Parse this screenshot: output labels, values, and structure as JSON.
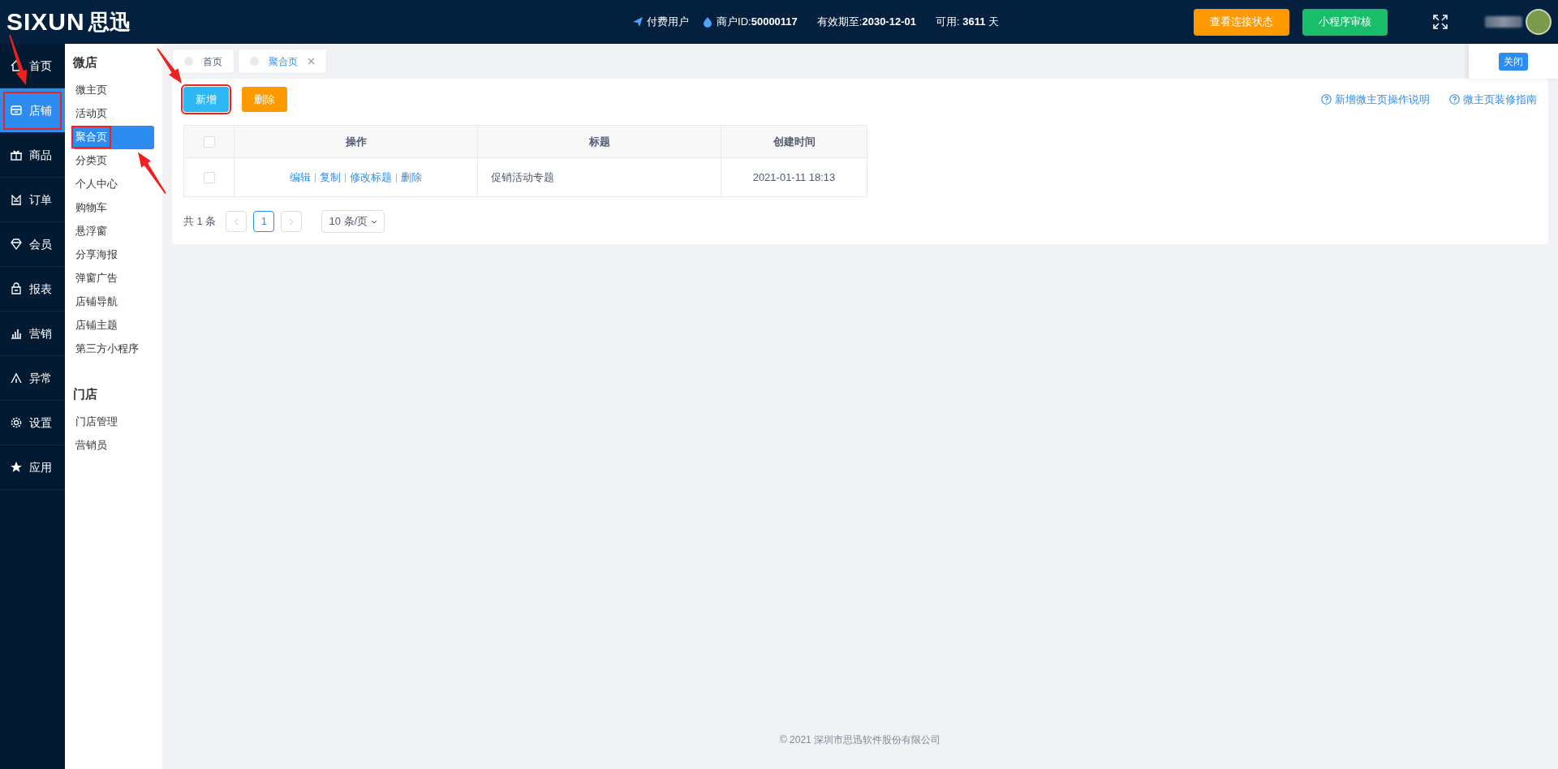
{
  "header": {
    "logo_latin": "SIXUN",
    "logo_cjk": "思迅",
    "user_type": "付费用户",
    "merchant_label": "商户ID:",
    "merchant_id": "50000117",
    "expiry_label": "有效期至:",
    "expiry": "2030-12-01",
    "available_label": "可用:",
    "available_days": "3611",
    "days_unit": "天",
    "buttons": [
      {
        "label": "查看连接状态",
        "kind": "warning"
      },
      {
        "label": "小程序审核",
        "kind": "success"
      }
    ]
  },
  "nav": [
    {
      "label": "首页",
      "selected": false,
      "highlighted": false
    },
    {
      "label": "店铺",
      "selected": true,
      "highlighted": true
    },
    {
      "label": "商品",
      "selected": false,
      "highlighted": false
    },
    {
      "label": "订单",
      "selected": false,
      "highlighted": false
    },
    {
      "label": "会员",
      "selected": false,
      "highlighted": false
    },
    {
      "label": "报表",
      "selected": false,
      "highlighted": false
    },
    {
      "label": "营销",
      "selected": false,
      "highlighted": false
    },
    {
      "label": "异常",
      "selected": false,
      "highlighted": false
    },
    {
      "label": "设置",
      "selected": false,
      "highlighted": false
    },
    {
      "label": "应用",
      "selected": false,
      "highlighted": false
    }
  ],
  "submenu": [
    {
      "title": "微店",
      "items": [
        {
          "label": "微主页",
          "selected": false,
          "highlighted": false
        },
        {
          "label": "活动页",
          "selected": false,
          "highlighted": false
        },
        {
          "label": "聚合页",
          "selected": true,
          "highlighted": true
        },
        {
          "label": "分类页",
          "selected": false,
          "highlighted": false
        },
        {
          "label": "个人中心",
          "selected": false,
          "highlighted": false
        },
        {
          "label": "购物车",
          "selected": false,
          "highlighted": false
        },
        {
          "label": "悬浮窗",
          "selected": false,
          "highlighted": false
        },
        {
          "label": "分享海报",
          "selected": false,
          "highlighted": false
        },
        {
          "label": "弹窗广告",
          "selected": false,
          "highlighted": false
        },
        {
          "label": "店铺导航",
          "selected": false,
          "highlighted": false
        },
        {
          "label": "店铺主题",
          "selected": false,
          "highlighted": false
        },
        {
          "label": "第三方小程序",
          "selected": false,
          "highlighted": false
        }
      ]
    },
    {
      "title": "门店",
      "items": [
        {
          "label": "门店管理",
          "selected": false,
          "highlighted": false
        },
        {
          "label": "营销员",
          "selected": false,
          "highlighted": false
        }
      ]
    }
  ],
  "tabs": [
    {
      "label": "首页",
      "selected": false,
      "closable": false
    },
    {
      "label": "聚合页",
      "selected": true,
      "closable": true
    }
  ],
  "close_panel": {
    "button": "关闭"
  },
  "toolbar": [
    {
      "label": "新增",
      "kind": "add",
      "highlighted": true
    },
    {
      "label": "删除",
      "kind": "delete",
      "highlighted": false
    }
  ],
  "help_links": [
    "新增微主页操作说明",
    "微主页装修指南"
  ],
  "table": {
    "header_checked": false,
    "columns": [
      "操作",
      "标题",
      "创建时间"
    ],
    "rows": [
      {
        "checked": false,
        "actions": [
          "编辑",
          "复制",
          "修改标题",
          "删除"
        ],
        "title": "促销活动专题",
        "created": "2021-01-11 18:13"
      }
    ]
  },
  "pagination": {
    "total": "共 1 条",
    "pages": [
      {
        "label": "1",
        "selected": true
      }
    ],
    "page_size": "10 条/页"
  },
  "footer": "© 2021 深圳市思迅软件股份有限公司"
}
